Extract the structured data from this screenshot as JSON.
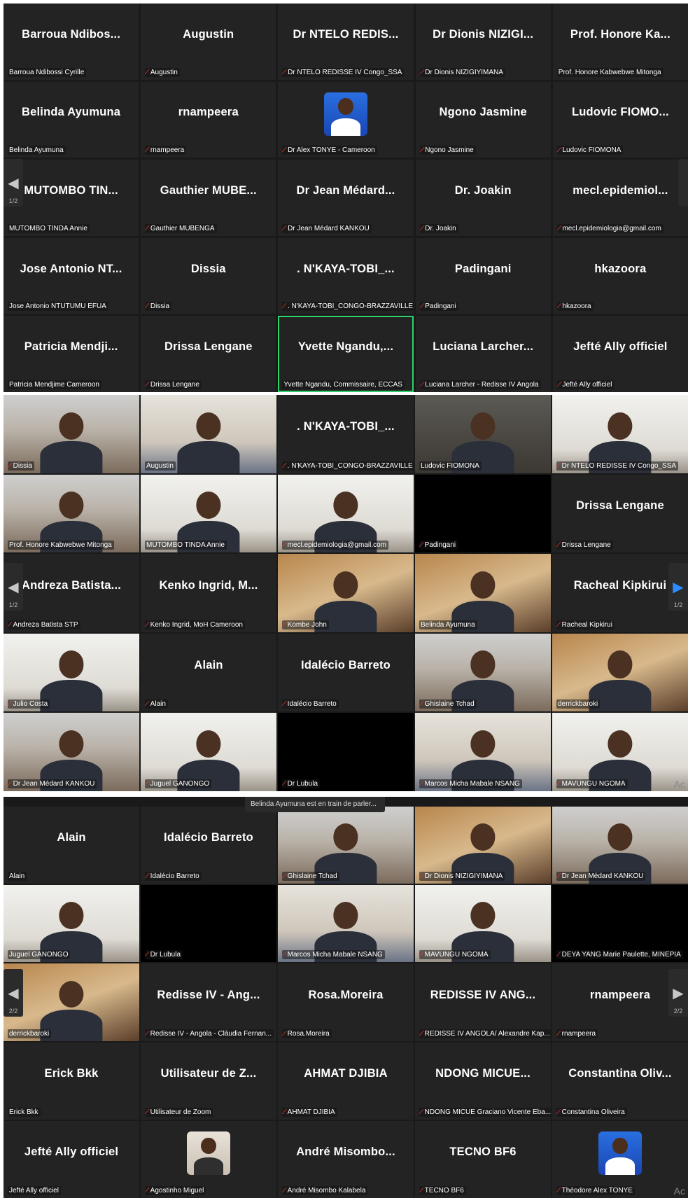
{
  "panels": [
    {
      "tiles": [
        {
          "big": "Barroua  Ndibos...",
          "label": "Barroua Ndibossi Cyrille",
          "muted": false
        },
        {
          "big": "Augustin",
          "label": "Augustin",
          "muted": true
        },
        {
          "big": "Dr  NTELO  REDIS...",
          "label": "Dr NTELO REDISSE IV Congo_SSA",
          "muted": true
        },
        {
          "big": "Dr  Dionis  NIZIGI...",
          "label": "Dr Dionis NIZIGIYIMANA",
          "muted": true
        },
        {
          "big": "Prof.  Honore  Ka...",
          "label": "Prof. Honore Kabwebwe Mitonga",
          "muted": false
        },
        {
          "big": "Belinda  Ayumuna",
          "label": "Belinda Ayumuna",
          "muted": false
        },
        {
          "big": "rnampeera",
          "label": "rnampeera",
          "muted": true
        },
        {
          "big": "",
          "label": "Dr Alex TONYE - Cameroon",
          "muted": true,
          "avatar": "blue"
        },
        {
          "big": "Ngono  Jasmine",
          "label": "Ngono Jasmine",
          "muted": true
        },
        {
          "big": "Ludovic  FIOMO...",
          "label": "Ludovic FIOMONA",
          "muted": true
        },
        {
          "big": "MUTOMBO  TIN...",
          "label": "MUTOMBO TINDA Annie",
          "muted": false
        },
        {
          "big": "Gauthier  MUBE...",
          "label": "Gauthier MUBENGA",
          "muted": true
        },
        {
          "big": "Dr  Jean  Médard...",
          "label": "Dr Jean Médard KANKOU",
          "muted": true
        },
        {
          "big": "Dr.  Joakin",
          "label": "Dr. Joakin",
          "muted": true
        },
        {
          "big": "mecl.epidemiol...",
          "label": "mecl.epidemiologia@gmail.com",
          "muted": true
        },
        {
          "big": "Jose  Antonio  NT...",
          "label": "Jose Antonio NTUTUMU EFUA",
          "muted": false
        },
        {
          "big": "Dissia",
          "label": "Dissia",
          "muted": true
        },
        {
          "big": ".  N'KAYA-TOBI_...",
          "label": ". N'KAYA-TOBI_CONGO-BRAZZAVILLE",
          "muted": true
        },
        {
          "big": "Padingani",
          "label": "Padingani",
          "muted": true
        },
        {
          "big": "hkazoora",
          "label": "hkazoora",
          "muted": true
        },
        {
          "big": "Patricia  Mendji...",
          "label": "Patricia Mendjime Cameroon",
          "muted": false
        },
        {
          "big": "Drissa  Lengane",
          "label": "Drissa Lengane",
          "muted": true
        },
        {
          "big": "Yvette  Ngandu,...",
          "label": "Yvette Ngandu, Commissaire, ECCAS",
          "muted": false,
          "speaker": true
        },
        {
          "big": "Luciana  Larcher...",
          "label": "Luciana Larcher - Redisse IV Angola",
          "muted": true
        },
        {
          "big": "Jefté Ally officiel",
          "label": "Jefté Ally officiel",
          "muted": true
        }
      ],
      "pager_left": {
        "arrow": "◀",
        "page": "1/2"
      },
      "pager_right": {
        "arrow": "",
        "page": ""
      }
    },
    {
      "tiles": [
        {
          "big": "",
          "label": "Dissia",
          "muted": true,
          "video": "v-room"
        },
        {
          "big": "",
          "label": "Augustin",
          "muted": false,
          "video": "v-office"
        },
        {
          "big": ".  N'KAYA-TOBI_...",
          "label": ". N'KAYA-TOBI_CONGO-BRAZZAVILLE",
          "muted": true
        },
        {
          "big": "",
          "label": "Ludovic FIOMONA",
          "muted": false,
          "video": "v-dark",
          "speaker": true
        },
        {
          "big": "",
          "label": "Dr NTELO REDISSE IV Congo_SSA",
          "muted": true,
          "video": "v-pale"
        },
        {
          "big": "",
          "label": "Prof. Honore Kabwebwe Mitonga",
          "muted": false,
          "video": "v-room"
        },
        {
          "big": "",
          "label": "MUTOMBO TINDA Annie",
          "muted": false,
          "video": "v-pale"
        },
        {
          "big": "",
          "label": "mecl.epidemiologia@gmail.com",
          "muted": true,
          "video": "v-pale"
        },
        {
          "big": "",
          "label": "Padingani",
          "muted": true,
          "black": true
        },
        {
          "big": "Drissa  Lengane",
          "label": "Drissa Lengane",
          "muted": true
        },
        {
          "big": "Andreza  Batista...",
          "label": "Andreza Batista STP",
          "muted": true
        },
        {
          "big": "Kenko  Ingrid,  M...",
          "label": "Kenko Ingrid, MoH Cameroon",
          "muted": true
        },
        {
          "big": "",
          "label": "Kombe John",
          "muted": true,
          "video": "v-warm"
        },
        {
          "big": "",
          "label": "Belinda Ayumuna",
          "muted": false,
          "video": "v-warm"
        },
        {
          "big": "Racheal  Kipkirui",
          "label": "Racheal Kipkirui",
          "muted": true
        },
        {
          "big": "",
          "label": "Julio Costa",
          "muted": true,
          "video": "v-pale"
        },
        {
          "big": "Alain",
          "label": "Alain",
          "muted": true
        },
        {
          "big": "Idalécio  Barreto",
          "label": "Idalécio Barreto",
          "muted": true
        },
        {
          "big": "",
          "label": "Ghislaine Tchad",
          "muted": true,
          "video": "v-room"
        },
        {
          "big": "",
          "label": "derrickbaroki",
          "muted": false,
          "video": "v-warm"
        },
        {
          "big": "",
          "label": "Dr Jean Médard KANKOU",
          "muted": true,
          "video": "v-room"
        },
        {
          "big": "",
          "label": "Juguel GANONGO",
          "muted": true,
          "video": "v-pale"
        },
        {
          "big": "",
          "label": "Dr Lubula",
          "muted": true,
          "black": true
        },
        {
          "big": "",
          "label": "Marcos Micha Mabale NSANG",
          "muted": true,
          "video": "v-office"
        },
        {
          "big": "",
          "label": "MAVUNGU NGOMA",
          "muted": true,
          "video": "v-pale"
        }
      ],
      "pager_left": {
        "arrow": "◀",
        "page": "1/2"
      },
      "pager_right": {
        "arrow": "▶",
        "page": "1/2"
      },
      "watermark": "Ac"
    },
    {
      "toast": "Belinda Ayumuna est en train de parler...",
      "tiles": [
        {
          "big": "Alain",
          "label": "Alain",
          "muted": false
        },
        {
          "big": "Idalécio  Barreto",
          "label": "Idalécio Barreto",
          "muted": true
        },
        {
          "big": "",
          "label": "Ghislaine Tchad",
          "muted": true,
          "video": "v-room"
        },
        {
          "big": "",
          "label": "Dr Dionis NIZIGIYIMANA",
          "muted": true,
          "video": "v-warm"
        },
        {
          "big": "",
          "label": "Dr Jean Médard KANKOU",
          "muted": true,
          "video": "v-room"
        },
        {
          "big": "",
          "label": "Juguel GANONGO",
          "muted": false,
          "video": "v-pale"
        },
        {
          "big": "",
          "label": "Dr Lubula",
          "muted": true,
          "black": true
        },
        {
          "big": "",
          "label": "Marcos Micha Mabale NSANG",
          "muted": true,
          "video": "v-office"
        },
        {
          "big": "",
          "label": "MAVUNGU NGOMA",
          "muted": true,
          "video": "v-pale"
        },
        {
          "big": "",
          "label": "DEYA YANG Marie Paulette, MINEPIA",
          "muted": true,
          "black": true
        },
        {
          "big": "",
          "label": "derrickbaroki",
          "muted": false,
          "video": "v-warm"
        },
        {
          "big": "Redisse  IV  -  Ang...",
          "label": "Redisse IV - Angola - Cláudia Fernan...",
          "muted": true
        },
        {
          "big": "Rosa.Moreira",
          "label": "Rosa.Moreira",
          "muted": true
        },
        {
          "big": "REDISSE  IV  ANG...",
          "label": "REDISSE IV ANGOLA/ Alexandre Kap...",
          "muted": true
        },
        {
          "big": "rnampeera",
          "label": "rnampeera",
          "muted": true
        },
        {
          "big": "Erick  Bkk",
          "label": "Erick Bkk",
          "muted": false
        },
        {
          "big": "Utilisateur  de  Z...",
          "label": "Utilisateur de Zoom",
          "muted": true
        },
        {
          "big": "AHMAT  DJIBIA",
          "label": "AHMAT DJIBIA",
          "muted": true
        },
        {
          "big": "NDONG  MICUE...",
          "label": "NDONG MICUE Graciano Vicente Eba...",
          "muted": true
        },
        {
          "big": "Constantina  Oliv...",
          "label": "Constantina Oliveira",
          "muted": true
        },
        {
          "big": "Jefté Ally officiel",
          "label": "Jefté Ally officiel",
          "muted": false
        },
        {
          "big": "",
          "label": "Agostinho Miguel",
          "muted": true,
          "avatar": "hat"
        },
        {
          "big": "André  Misombo...",
          "label": "André Misombo Kalabela",
          "muted": true
        },
        {
          "big": "TECNO  BF6",
          "label": "TECNO BF6",
          "muted": true
        },
        {
          "big": "",
          "label": "Théodore Alex TONYE",
          "muted": true,
          "avatar": "blue"
        }
      ],
      "pager_left": {
        "arrow": "◀",
        "page": "2/2"
      },
      "pager_right": {
        "arrow": "▶",
        "page": "2/2"
      },
      "watermark": "Ac"
    }
  ]
}
